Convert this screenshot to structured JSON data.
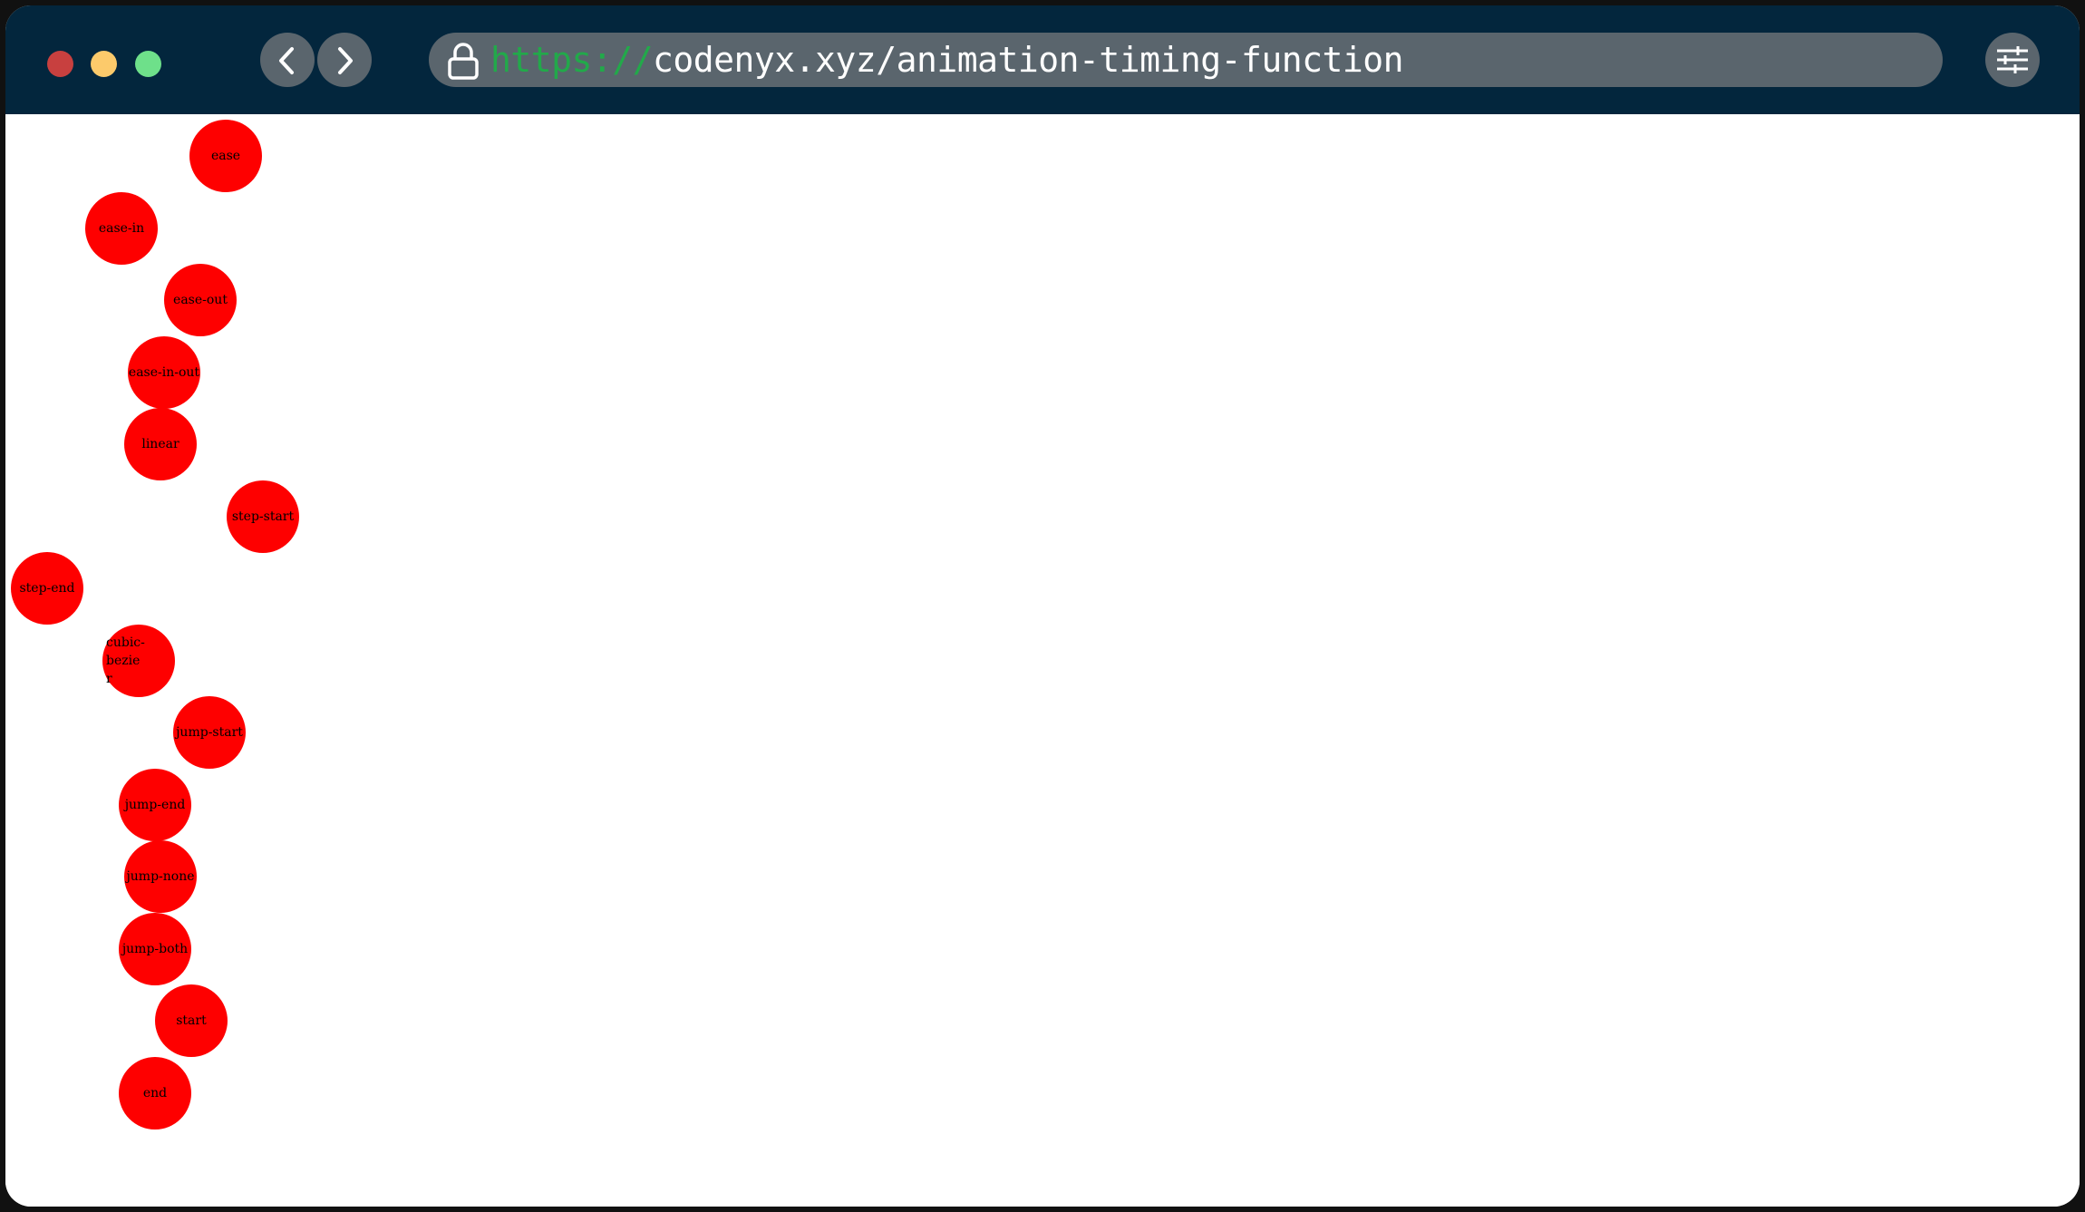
{
  "browser": {
    "url_scheme": "https://",
    "url_rest": "codenyx.xyz/animation-timing-function"
  },
  "balls": [
    {
      "label": "ease"
    },
    {
      "label": "ease-in"
    },
    {
      "label": "ease-out"
    },
    {
      "label": "ease-in-out"
    },
    {
      "label": "linear"
    },
    {
      "label": "step-start"
    },
    {
      "label": "step-end"
    },
    {
      "label": "cubic-bezier"
    },
    {
      "label": "jump-start"
    },
    {
      "label": "jump-end"
    },
    {
      "label": "jump-none"
    },
    {
      "label": "jump-both"
    },
    {
      "label": "start"
    },
    {
      "label": "end"
    }
  ],
  "colors": {
    "titlebar": "#03263d",
    "ball": "#fe0000",
    "url_scheme": "#22a94a"
  }
}
